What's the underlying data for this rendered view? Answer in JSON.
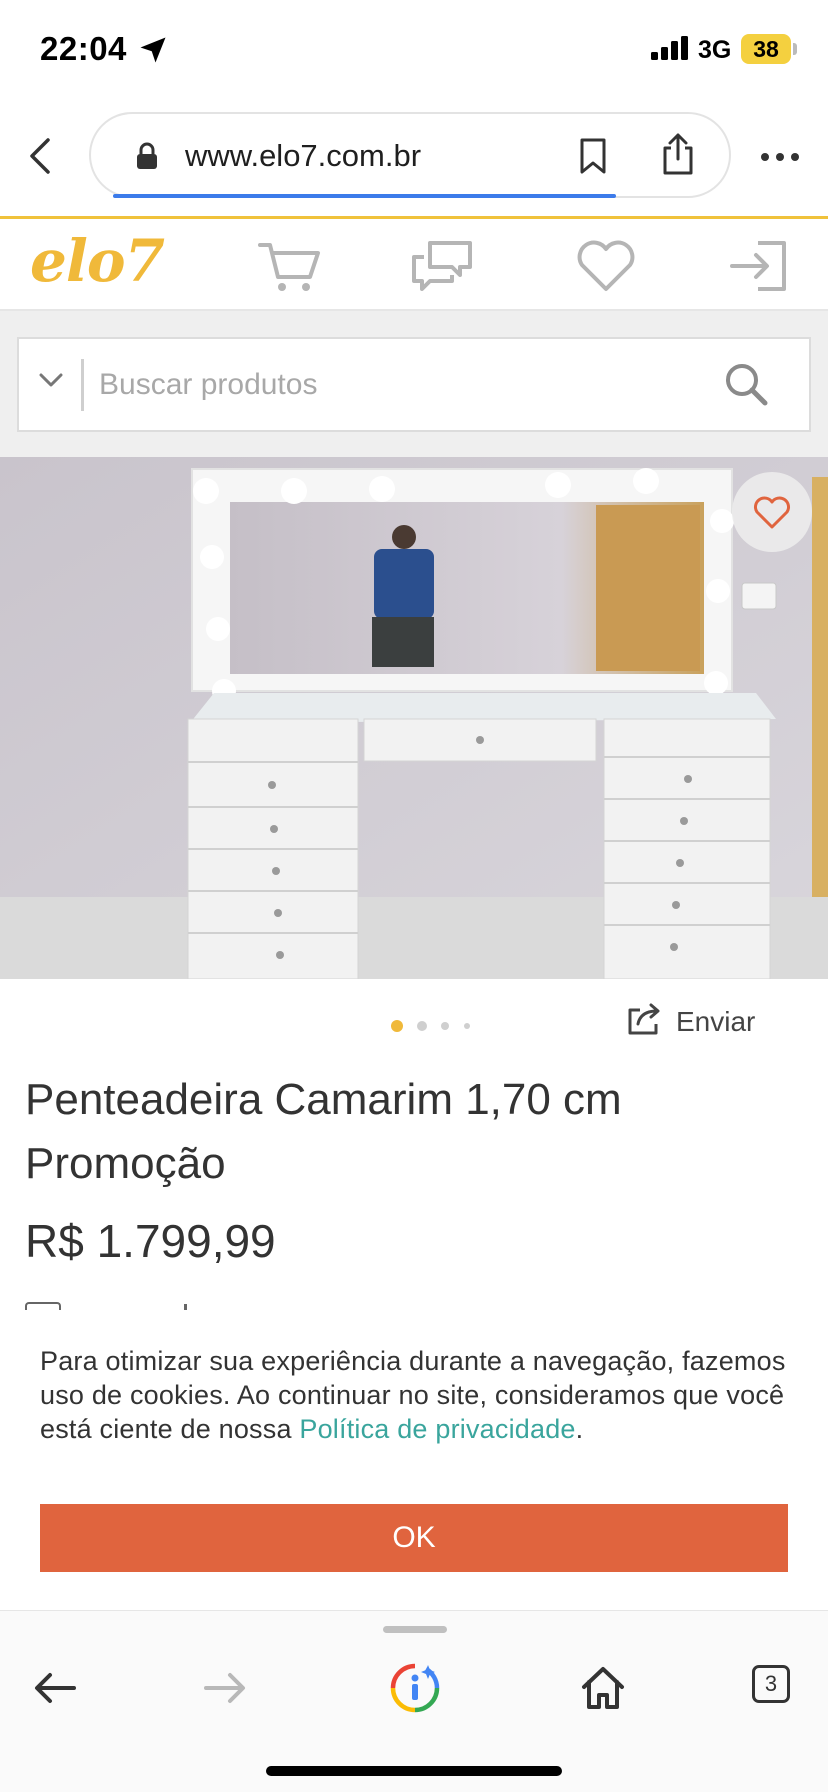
{
  "status_bar": {
    "time": "22:04",
    "network": "3G",
    "battery": "38",
    "battery_color": "#f4d03f"
  },
  "browser": {
    "url": "www.elo7.com.br",
    "page_load_progress": 0.85,
    "accent_color": "#3c7bea"
  },
  "site_header": {
    "logo": "elo7",
    "brand_color": "#f0b93a",
    "icons": [
      "cart-icon",
      "chat-icon",
      "heart-icon",
      "login-icon"
    ]
  },
  "search": {
    "placeholder": "Buscar produtos"
  },
  "carousel": {
    "total_images": 4,
    "active_index": 0,
    "active_dot_color": "#f0b93a"
  },
  "share": {
    "label": "Enviar"
  },
  "product": {
    "title": "Penteadeira Camarim 1,70 cm Promoção",
    "price": "R$ 1.799,99"
  },
  "cookie_banner": {
    "text": "Para otimizar sua experiência durante a navegação, fazemos uso de cookies. Ao continuar no site, consideramos que você está ciente de nossa ",
    "link_text": "Política de privacidade",
    "after_link": ".",
    "button_label": "OK",
    "link_color": "#3aa59d",
    "button_color": "#e0643e"
  },
  "toolbar": {
    "tabs_count": "3"
  }
}
